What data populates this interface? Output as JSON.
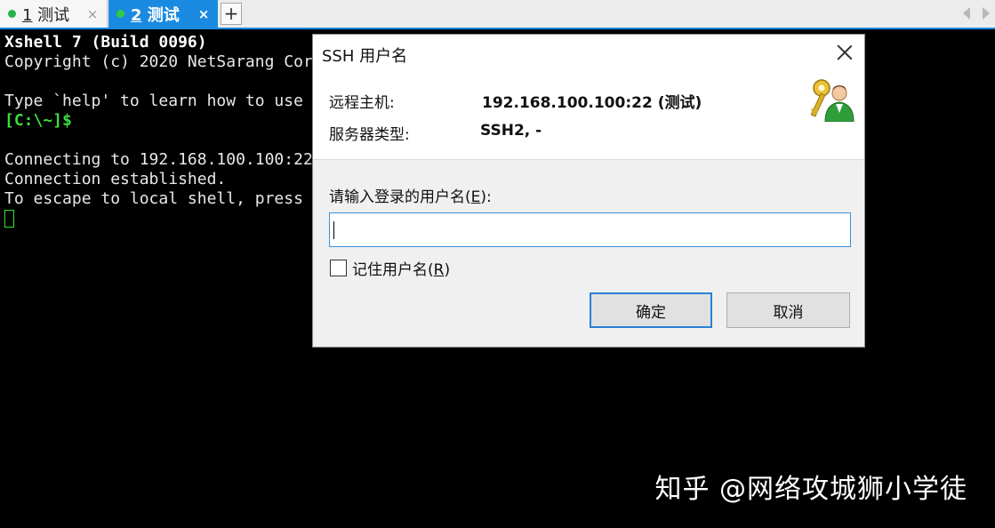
{
  "tabs": [
    {
      "number": "1",
      "label": " 测试",
      "close": "×"
    },
    {
      "number": "2",
      "label": " 测试",
      "close": "×"
    }
  ],
  "tabbar": {
    "add": "+"
  },
  "terminal": {
    "lines": [
      "Xshell 7 (Build 0096)",
      "Copyright (c) 2020 NetSarang Cor",
      "",
      "Type `help' to learn how to use",
      "[C:\\~]$",
      "",
      "Connecting to 192.168.100.100:22",
      "Connection established.",
      "To escape to local shell, press"
    ]
  },
  "dialog": {
    "title": "SSH 用户名",
    "remote_host_label": "远程主机:",
    "remote_host_value": "192.168.100.100:22 (测试)",
    "server_type_label": "服务器类型:",
    "server_type_value": "SSH2, -",
    "prompt_pre": "请输入登录的用户名(",
    "prompt_key": "E",
    "prompt_post": "):",
    "username_value": "",
    "remember_pre": "记住用户名(",
    "remember_key": "R",
    "remember_post": ")",
    "remember_checked": false,
    "ok_label": "确定",
    "cancel_label": "取消"
  },
  "watermark": "知乎 @网络攻城狮小学徒",
  "colors": {
    "accent": "#1a8ae0",
    "prompt_green": "#3ddc3d",
    "terminal_bg": "#000000",
    "dialog_bg": "#f0f0f0"
  }
}
